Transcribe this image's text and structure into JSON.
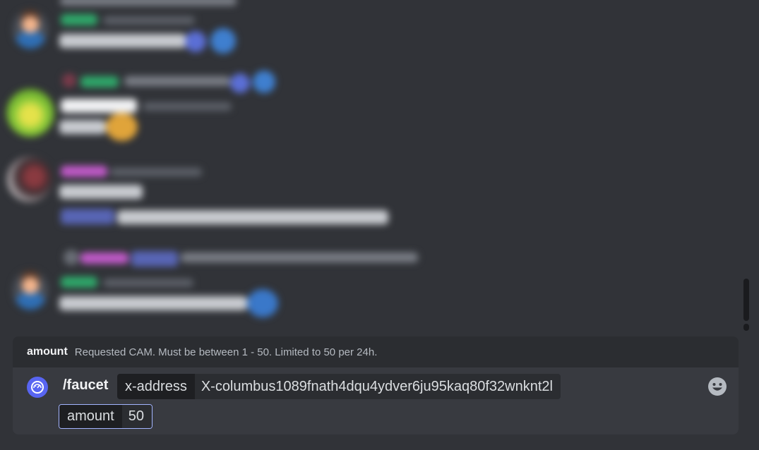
{
  "option_hint": {
    "name": "amount",
    "description": "Requested CAM. Must be between 1 - 50. Limited to 50 per 24h."
  },
  "composer": {
    "command": "/faucet",
    "options": [
      {
        "key": "x-address",
        "value": "X-columbus1089fnath4dqu4ydver6ju95kaq80f32wnknt2l"
      },
      {
        "key": "amount",
        "value": "50"
      }
    ],
    "active_option": "amount"
  },
  "icons": {
    "bot": "bot-app-icon",
    "emoji": "emoji-picker-icon"
  },
  "colors": {
    "background": "#313338",
    "hint_bar": "#2b2d31",
    "composer": "#383a40",
    "accent": "#5865f2",
    "active_border": "#a3b4ff"
  }
}
